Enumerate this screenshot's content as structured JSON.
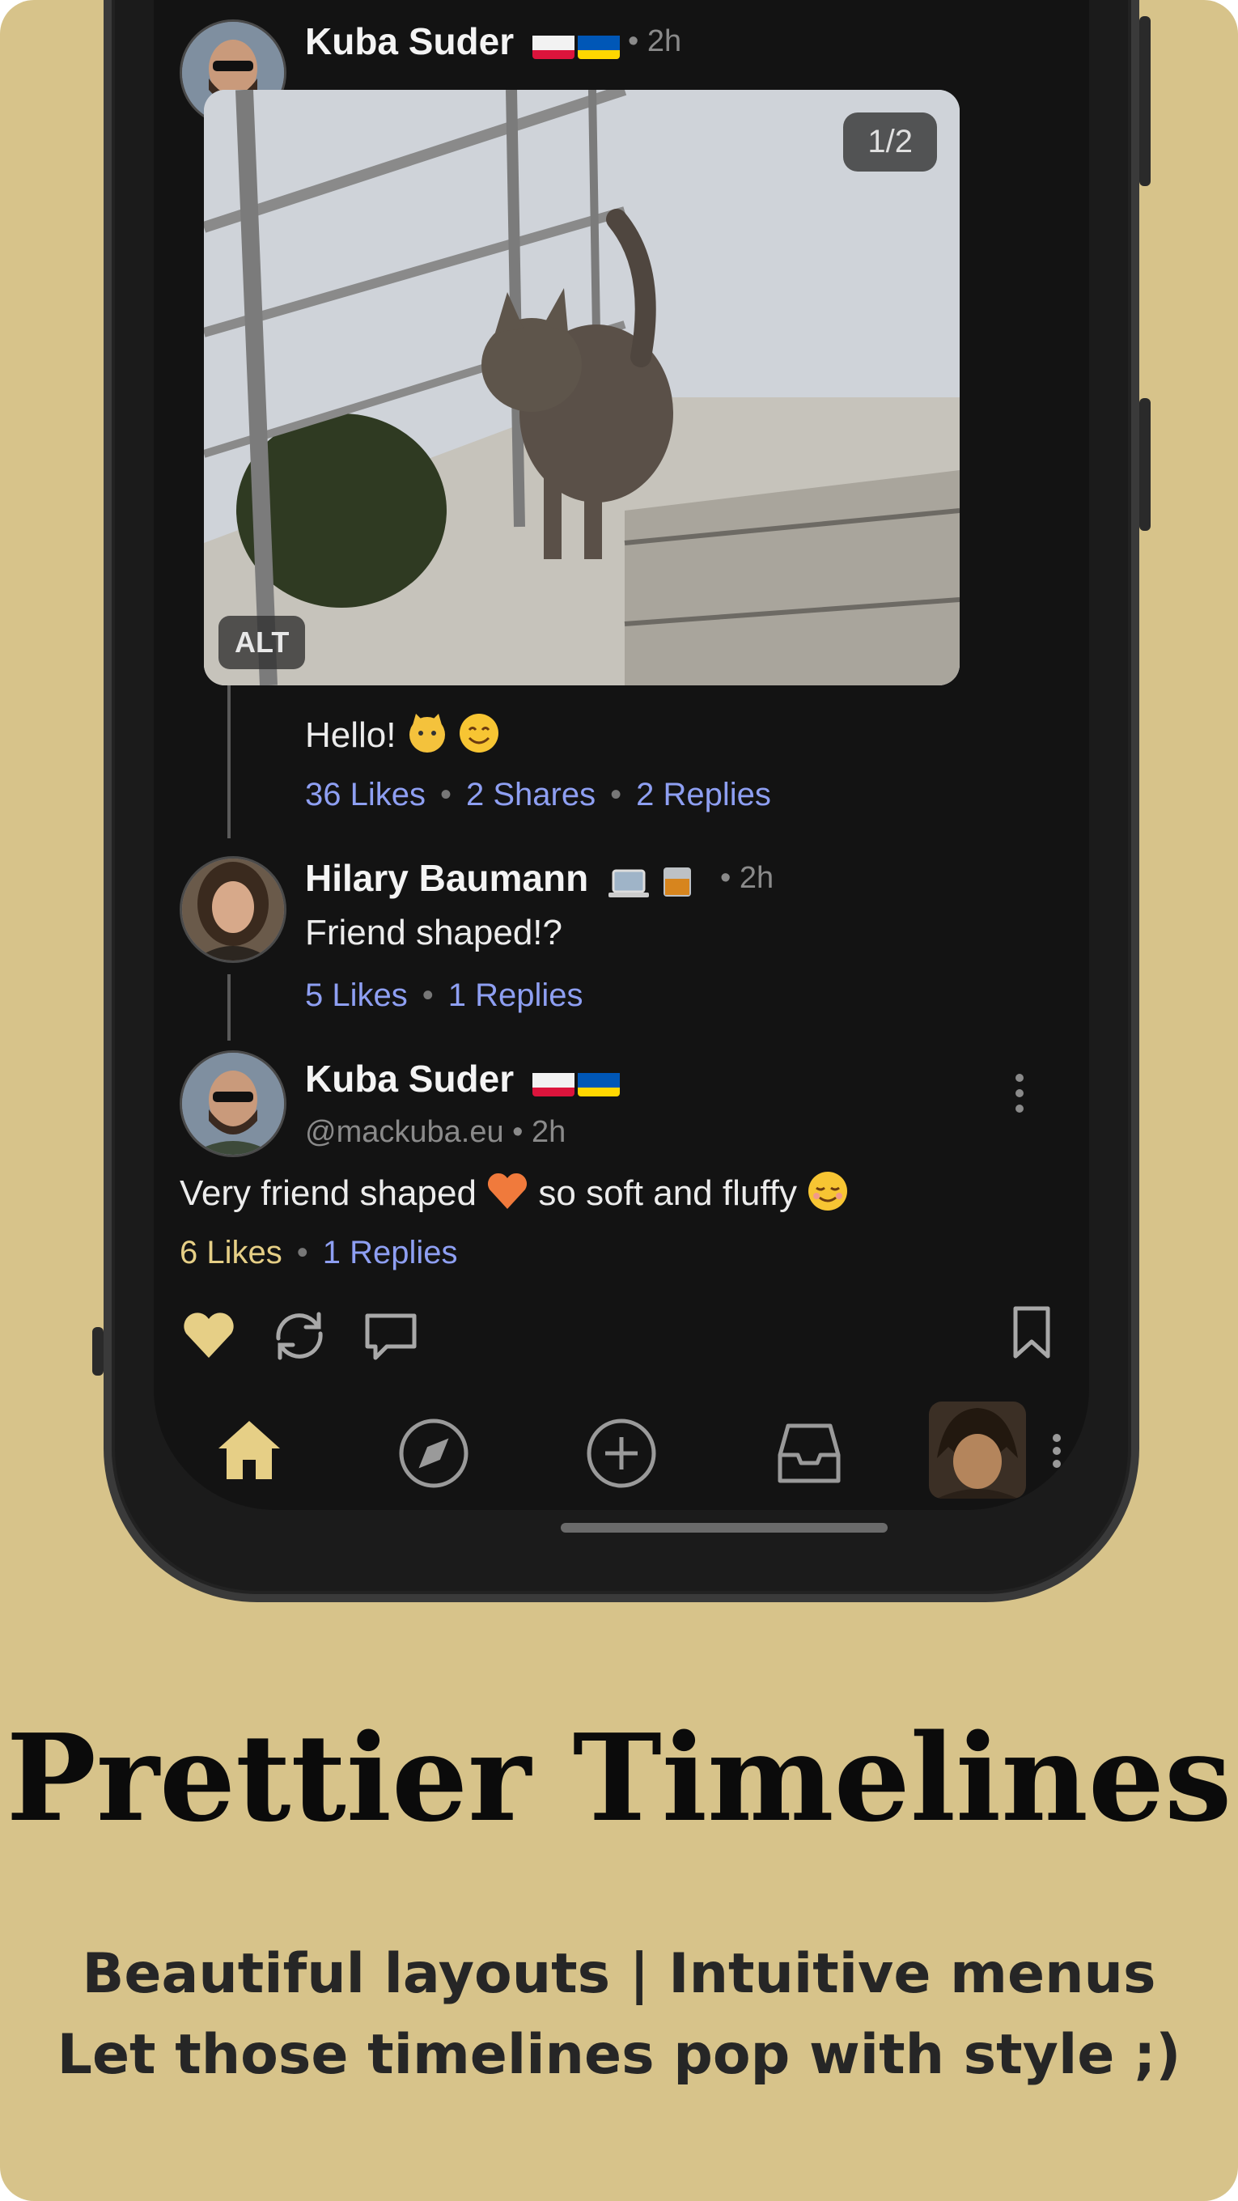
{
  "posts": [
    {
      "author": "Kuba Suder",
      "time": "• 2h",
      "media_counter": "1/2",
      "alt_label": "ALT",
      "text": "Hello!",
      "stats": {
        "likes": "36 Likes",
        "shares": "2 Shares",
        "replies": "2 Replies"
      }
    },
    {
      "author": "Hilary Baumann",
      "time": "• 2h",
      "text": "Friend shaped!?",
      "stats": {
        "likes": "5 Likes",
        "replies": "1 Replies"
      }
    },
    {
      "author": "Kuba Suder",
      "handle_time": "@mackuba.eu • 2h",
      "text_before": "Very friend shaped",
      "text_after": "so soft and fluffy",
      "stats": {
        "likes": "6 Likes",
        "replies": "1 Replies"
      }
    }
  ],
  "icons": {
    "actions": [
      "heart-icon",
      "repost-icon",
      "reply-icon",
      "bookmark-icon",
      "more-vertical-icon"
    ],
    "tabbar": [
      "home-icon",
      "compass-icon",
      "plus-circle-icon",
      "inbox-icon",
      "profile-avatar",
      "more-vertical-icon"
    ]
  },
  "colors": {
    "background": "#d7c38a",
    "screen": "#131313",
    "link": "#8e9ff2",
    "liked": "#e6cf86"
  },
  "promo": {
    "headline": "Prettier Timelines",
    "line1": "Beautiful layouts | Intuitive menus",
    "line2": "Let those timelines pop with style ;)"
  }
}
